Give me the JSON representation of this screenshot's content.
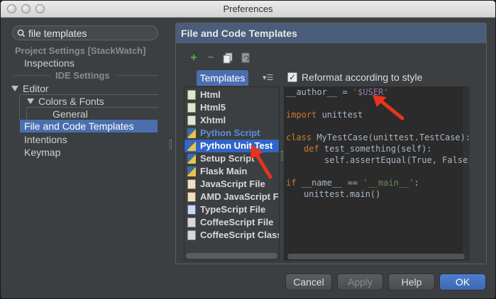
{
  "window": {
    "title": "Preferences"
  },
  "search": {
    "value": "file templates"
  },
  "settings_tree": {
    "project_group": "Project Settings [StackWatch]",
    "inspections": "Inspections",
    "ide_group": "IDE Settings",
    "editor": "Editor",
    "colors_fonts": "Colors & Fonts",
    "general": "General",
    "file_code_templates": "File and Code Templates",
    "intentions": "Intentions",
    "keymap": "Keymap"
  },
  "panel": {
    "header": "File and Code Templates",
    "tab_templates": "Templates",
    "reformat_label": "Reformat according to style",
    "reformat_checked": true
  },
  "templates": [
    {
      "label": "Html",
      "icon": "html-file-icon",
      "kind": "html"
    },
    {
      "label": "Html5",
      "icon": "html-file-icon",
      "kind": "html"
    },
    {
      "label": "Xhtml",
      "icon": "html-file-icon",
      "kind": "html"
    },
    {
      "label": "Python Script",
      "icon": "python-file-icon",
      "kind": "py"
    },
    {
      "label": "Python Unit Test",
      "icon": "python-file-icon",
      "kind": "py",
      "selected": true
    },
    {
      "label": "Setup Script",
      "icon": "python-file-icon",
      "kind": "py"
    },
    {
      "label": "Flask Main",
      "icon": "python-file-icon",
      "kind": "py"
    },
    {
      "label": "JavaScript File",
      "icon": "javascript-file-icon",
      "kind": "js"
    },
    {
      "label": "AMD JavaScript Fi",
      "icon": "javascript-file-icon",
      "kind": "js"
    },
    {
      "label": "TypeScript File",
      "icon": "typescript-file-icon",
      "kind": "ts"
    },
    {
      "label": "CoffeeScript File",
      "icon": "coffeescript-file-icon",
      "kind": "cs"
    },
    {
      "label": "CoffeeScript Class",
      "icon": "coffeescript-file-icon",
      "kind": "cs"
    }
  ],
  "code": {
    "l1_a": "__author__ = ",
    "l1_q": "'",
    "l1_var": "$USER",
    "l1_q2": "'",
    "l3_kw": "import",
    "l3_rest": " unittest",
    "l5_kw": "class",
    "l5_rest": " MyTestCase(unittest.TestCase):",
    "l6_kw": "def",
    "l6_rest": " test_something(self):",
    "l7": "self.assertEqual(True, False)",
    "l9_kw": "if",
    "l9_mid": " __name__ == ",
    "l9_str": "'__main__'",
    "l9_end": ":",
    "l10": "unittest.main()"
  },
  "buttons": {
    "cancel": "Cancel",
    "apply": "Apply",
    "help": "Help",
    "ok": "OK"
  },
  "colors": {
    "selection": "#4b6eaf",
    "list_selection": "#2f65ca",
    "annotation_arrow": "#e8331c"
  }
}
